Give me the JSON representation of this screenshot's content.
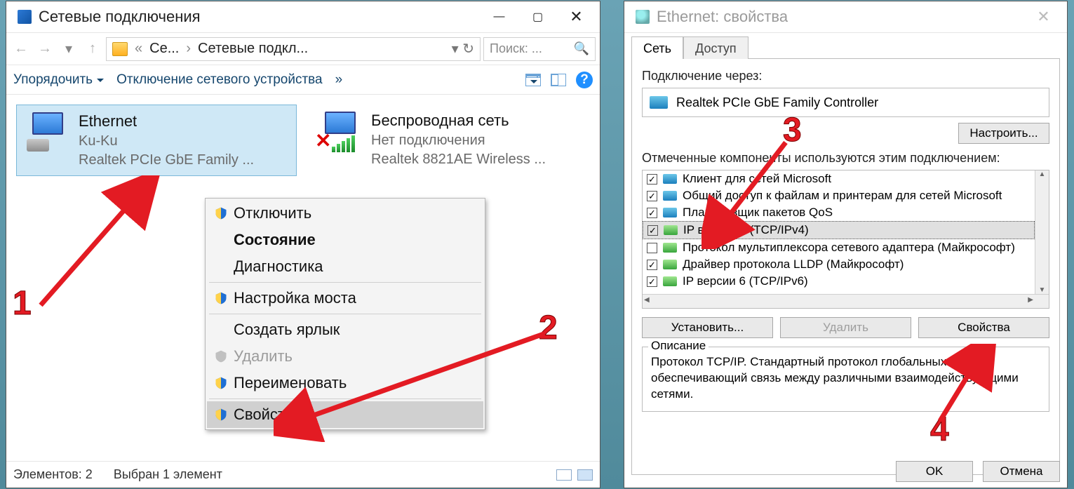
{
  "left": {
    "title": "Сетевые подключения",
    "breadcrumbs": [
      "Се...",
      "Сетевые подкл..."
    ],
    "search_placeholder": "Поиск: ...",
    "toolbar": {
      "organize": "Упорядочить",
      "disable": "Отключение сетевого устройства"
    },
    "connections": [
      {
        "name": "Ethernet",
        "line2": "Ku-Ku",
        "line3": "Realtek PCIe GbE Family ..."
      },
      {
        "name": "Беспроводная сеть",
        "line2": "Нет подключения",
        "line3": "Realtek 8821AE Wireless ..."
      }
    ],
    "context_menu": {
      "disable": "Отключить",
      "status": "Состояние",
      "diagnose": "Диагностика",
      "bridge": "Настройка моста",
      "shortcut": "Создать ярлык",
      "delete": "Удалить",
      "rename": "Переименовать",
      "properties": "Свойства"
    },
    "status": {
      "count": "Элементов: 2",
      "selected": "Выбран 1 элемент"
    }
  },
  "right": {
    "title": "Ethernet: свойства",
    "tabs": {
      "net": "Сеть",
      "access": "Доступ"
    },
    "connect_via_lbl": "Подключение через:",
    "connect_via": "Realtek PCIe GbE Family Controller",
    "configure_btn": "Настроить...",
    "components_lbl": "Отмеченные компоненты используются этим подключением:",
    "components": [
      {
        "checked": true,
        "label": "Клиент для сетей Microsoft"
      },
      {
        "checked": true,
        "label": "Общий доступ к файлам и принтерам для сетей Microsoft"
      },
      {
        "checked": true,
        "label": "Планировщик пакетов QoS"
      },
      {
        "checked": true,
        "label": "IP версии 4 (TCP/IPv4)"
      },
      {
        "checked": false,
        "label": "Протокол мультиплексора сетевого адаптера (Майкрософт)"
      },
      {
        "checked": true,
        "label": "Драйвер протокола LLDP (Майкрософт)"
      },
      {
        "checked": true,
        "label": "IP версии 6 (TCP/IPv6)"
      }
    ],
    "buttons": {
      "install": "Установить...",
      "remove": "Удалить",
      "properties": "Свойства"
    },
    "description": {
      "legend": "Описание",
      "text": "Протокол TCP/IP. Стандартный протокол глобальных сетей, обеспечивающий связь между различными взаимодействующими сетями."
    },
    "ok": "OK",
    "cancel": "Отмена"
  },
  "annotations": {
    "n1": "1",
    "n2": "2",
    "n3": "3",
    "n4": "4"
  }
}
